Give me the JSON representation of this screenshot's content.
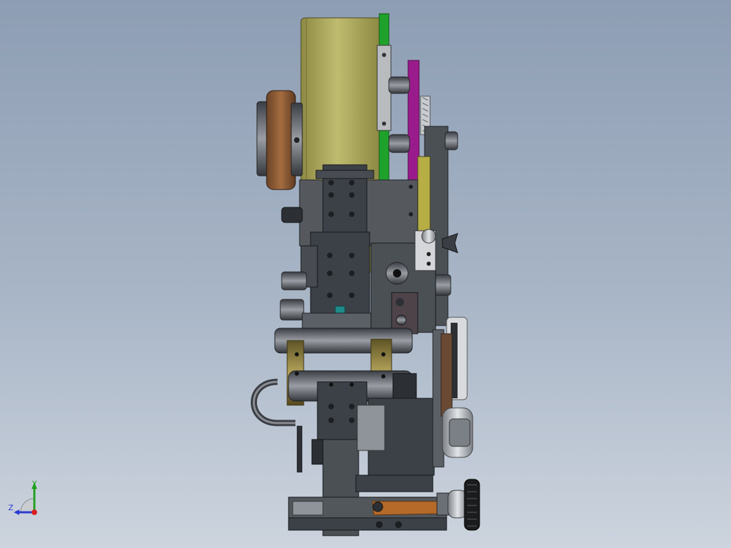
{
  "view": {
    "type": "cad-3d-model-side-view",
    "background_gradient": [
      "#8d9db3",
      "#a9b6c7",
      "#cdd4de"
    ]
  },
  "triad": {
    "y_label": "Y",
    "z_label": "Z",
    "colors": {
      "y": "#1ea01e",
      "z": "#2a3ad0",
      "x": "#d81e1e"
    }
  },
  "colors": {
    "body_dark": "#3c4147",
    "body_mid": "#55595e",
    "olive_drum": "#a8a45a",
    "brass": "#8a7a3a",
    "copper_wheel": "#8a5a34",
    "green_plate": "#1fa22c",
    "purple_arm": "#9a1c8c",
    "orange_lever": "#b56a2a",
    "light_metal": "#c8ccd0"
  }
}
